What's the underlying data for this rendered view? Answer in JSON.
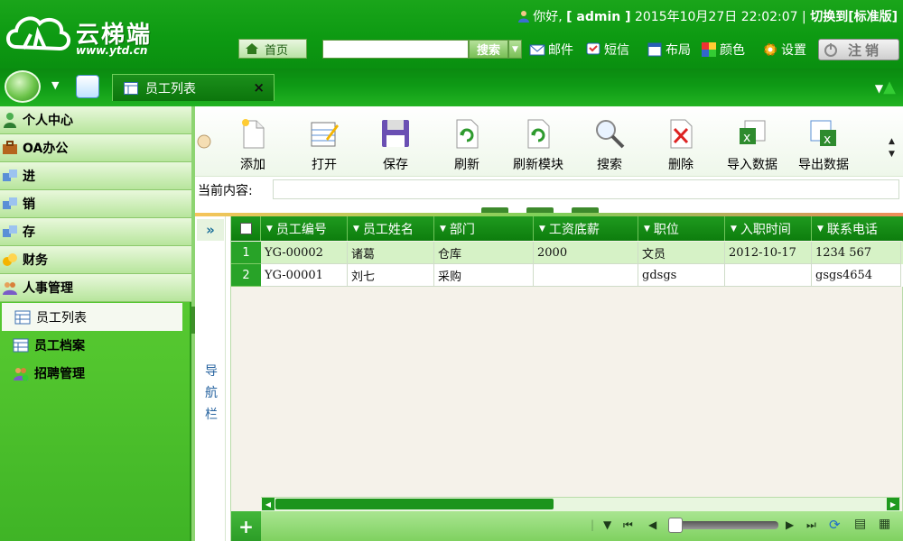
{
  "header": {
    "logo_text": "云梯端",
    "logo_sub": "www.ytd.cn",
    "greeting": "你好,",
    "username": "[ admin ]",
    "datetime": "2015年10月27日 22:02:07",
    "separator": "|",
    "switch_label": "切换到[标准版]",
    "home_label": "首页",
    "search_value": "",
    "search_label": "搜索",
    "links": {
      "mail": "邮件",
      "sms": "短信",
      "layout": "布局",
      "color": "颜色",
      "settings": "设置"
    },
    "logout_label": "注销"
  },
  "tabs": [
    {
      "label": "员工列表",
      "close": "×"
    }
  ],
  "sidebar": {
    "items": [
      {
        "label": "个人中心"
      },
      {
        "label": "OA办公"
      },
      {
        "label": "进"
      },
      {
        "label": "销"
      },
      {
        "label": "存"
      },
      {
        "label": "财务"
      },
      {
        "label": "人事管理"
      }
    ],
    "subitems": [
      {
        "label": "员工列表"
      },
      {
        "label": "员工档案"
      },
      {
        "label": "招聘管理"
      }
    ]
  },
  "toolbar": {
    "add": "添加",
    "open": "打开",
    "save": "保存",
    "refresh": "刷新",
    "refresh_module": "刷新模块",
    "search": "搜索",
    "delete": "删除",
    "import": "导入数据",
    "export": "导出数据"
  },
  "current_content_label": "当前内容:",
  "nav_panel": {
    "expand": "»",
    "c1": "导",
    "c2": "航",
    "c3": "栏"
  },
  "grid": {
    "columns": [
      "员工编号",
      "员工姓名",
      "部门",
      "工资底薪",
      "职位",
      "入职时间",
      "联系电话"
    ],
    "rows": [
      {
        "num": "1",
        "cells": [
          "YG-00002",
          "诸葛",
          "仓库",
          "2000",
          "文员",
          "2012-10-17",
          "1234 567"
        ]
      },
      {
        "num": "2",
        "cells": [
          "YG-00001",
          "刘七",
          "采购",
          "",
          "gdsgs",
          "",
          "gsgs4654"
        ]
      }
    ]
  },
  "pager": {
    "add": "+"
  },
  "colors": {
    "brand_green": "#0d9a12",
    "grid_header": "#1f9a1f",
    "selected_row": "#d6f2c6"
  }
}
